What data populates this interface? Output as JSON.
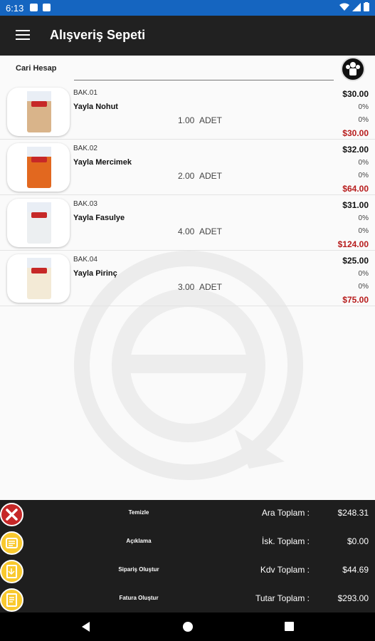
{
  "status_bar": {
    "time": "6:13"
  },
  "app_bar": {
    "title": "Alışveriş Sepeti"
  },
  "account": {
    "label": "Cari Hesap"
  },
  "items": [
    {
      "code": "BAK.01",
      "name": "Yayla Nohut",
      "quantity": "1.00",
      "unit": "ADET",
      "price": "$30.00",
      "discount": "0%",
      "tax": "0%",
      "total": "$30.00",
      "bag_color": "#d9b48a"
    },
    {
      "code": "BAK.02",
      "name": "Yayla Mercimek",
      "quantity": "2.00",
      "unit": "ADET",
      "price": "$32.00",
      "discount": "0%",
      "tax": "0%",
      "total": "$64.00",
      "bag_color": "#e2681f"
    },
    {
      "code": "BAK.03",
      "name": "Yayla Fasulye",
      "quantity": "4.00",
      "unit": "ADET",
      "price": "$31.00",
      "discount": "0%",
      "tax": "0%",
      "total": "$124.00",
      "bag_color": "#eceff1"
    },
    {
      "code": "BAK.04",
      "name": "Yayla Pirinç",
      "quantity": "3.00",
      "unit": "ADET",
      "price": "$25.00",
      "discount": "0%",
      "tax": "0%",
      "total": "$75.00",
      "bag_color": "#f3ead6"
    }
  ],
  "bottom": {
    "actions": [
      {
        "label": "Temizle",
        "icon": "close-icon"
      },
      {
        "label": "Açıklama",
        "icon": "notes-icon"
      },
      {
        "label": "Sipariş Oluştur",
        "icon": "order-icon"
      },
      {
        "label": "Fatura Oluştur",
        "icon": "invoice-icon"
      }
    ],
    "totals": [
      {
        "label": "Ara Toplam :",
        "value": "$248.31"
      },
      {
        "label": "İsk. Toplam :",
        "value": "$0.00"
      },
      {
        "label": "Kdv Toplam :",
        "value": "$44.69"
      },
      {
        "label": "Tutar Toplam :",
        "value": "$293.00"
      }
    ]
  },
  "colors": {
    "app_bar": "#212121",
    "status_bar": "#1565c0",
    "accent_total": "#b71c1c",
    "gold": "#f9c92e",
    "red": "#c62828"
  }
}
